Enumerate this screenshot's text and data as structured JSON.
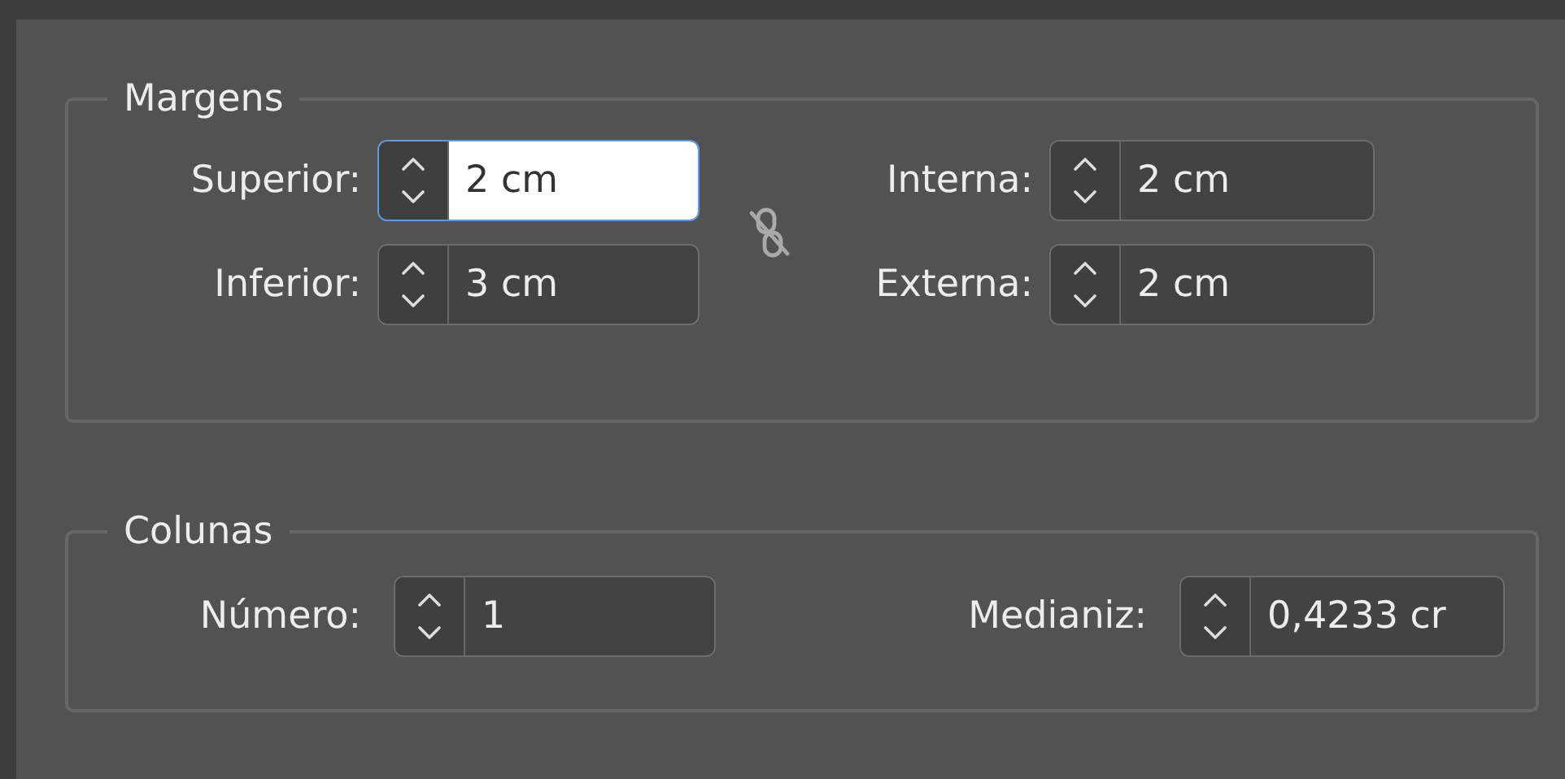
{
  "groups": [
    {
      "title": "Margens",
      "kind": "margins",
      "linked": false,
      "fields": [
        {
          "label": "Superior:",
          "value": "2 cm",
          "focused": true
        },
        {
          "label": "Interna:",
          "value": "2 cm",
          "focused": false
        },
        {
          "label": "Inferior:",
          "value": "3 cm",
          "focused": false
        },
        {
          "label": "Externa:",
          "value": "2 cm",
          "focused": false
        }
      ]
    },
    {
      "title": "Colunas",
      "kind": "columns",
      "fields": [
        {
          "label": "Número:",
          "value": "1",
          "focused": false
        },
        {
          "label": "Medianiz:",
          "value": "0,4233 cr",
          "focused": false
        }
      ]
    }
  ]
}
